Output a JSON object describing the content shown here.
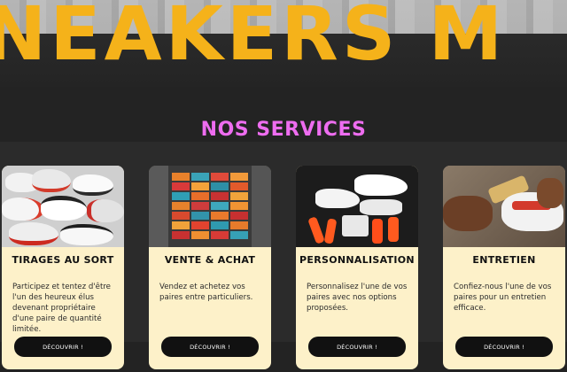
{
  "hero": {
    "title": "NEAKERS M"
  },
  "section": {
    "title": "NOS SERVICES"
  },
  "cards": [
    {
      "title": "TIRAGES AU SORT",
      "text": "Participez et tentez d'être l'un des heureux élus devenant propriétaire d'une paire de quantité limitée.",
      "button": "DÉCOUVRIR !",
      "image": "sneaker-pile-photo"
    },
    {
      "title": "VENTE & ACHAT",
      "text": "Vendez et achetez vos paires entre particuliers.",
      "button": "DÉCOUVRIR !",
      "image": "shoe-boxes-van-photo"
    },
    {
      "title": "PERSONNALISATION",
      "text": "Personnalisez l'une de vos paires avec nos options proposées.",
      "button": "DÉCOUVRIR !",
      "image": "white-sneakers-laces-photo"
    },
    {
      "title": "ENTRETIEN",
      "text": "Confiez-nous l'une de vos paires pour un entretien efficace.",
      "button": "DÉCOUVRIR !",
      "image": "sneaker-cleaning-photo"
    }
  ],
  "colors": {
    "accent_yellow": "#f5b21a",
    "accent_pink": "#ee6df0",
    "card_bg": "#fdf1c9",
    "page_bg": "#232323"
  }
}
